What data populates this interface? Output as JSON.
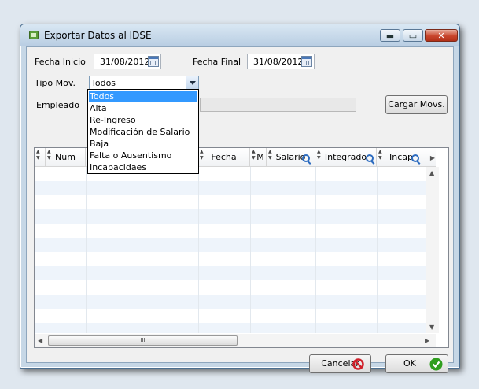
{
  "window": {
    "title": "Exportar Datos al IDSE",
    "min_label": "▬",
    "max_label": "▭",
    "close_label": "✕"
  },
  "form": {
    "fecha_inicio_label": "Fecha Inicio",
    "fecha_inicio_value": "31/08/2012",
    "fecha_final_label": "Fecha Final",
    "fecha_final_value": "31/08/2012",
    "tipo_mov_label": "Tipo Mov.",
    "tipo_mov_value": "Todos",
    "empleado_label": "Empleado",
    "cargar_label": "Cargar Movs."
  },
  "dropdown": {
    "options": [
      "Todos",
      "Alta",
      "Re-Ingreso",
      "Modificación de Salario",
      "Baja",
      "Falta o Ausentismo",
      "Incapacidaes"
    ],
    "selected_index": 0
  },
  "table": {
    "columns": [
      "Num",
      "",
      "Fecha",
      "M",
      "Salario",
      "Integrado",
      "Incap"
    ],
    "scroll_thumb_label": "III"
  },
  "footer": {
    "cancel_label": "Cancelar",
    "ok_label": "OK"
  },
  "colors": {
    "selection": "#3399ff",
    "cancel_icon": "#d0202a",
    "ok_icon": "#2f9e1e"
  }
}
